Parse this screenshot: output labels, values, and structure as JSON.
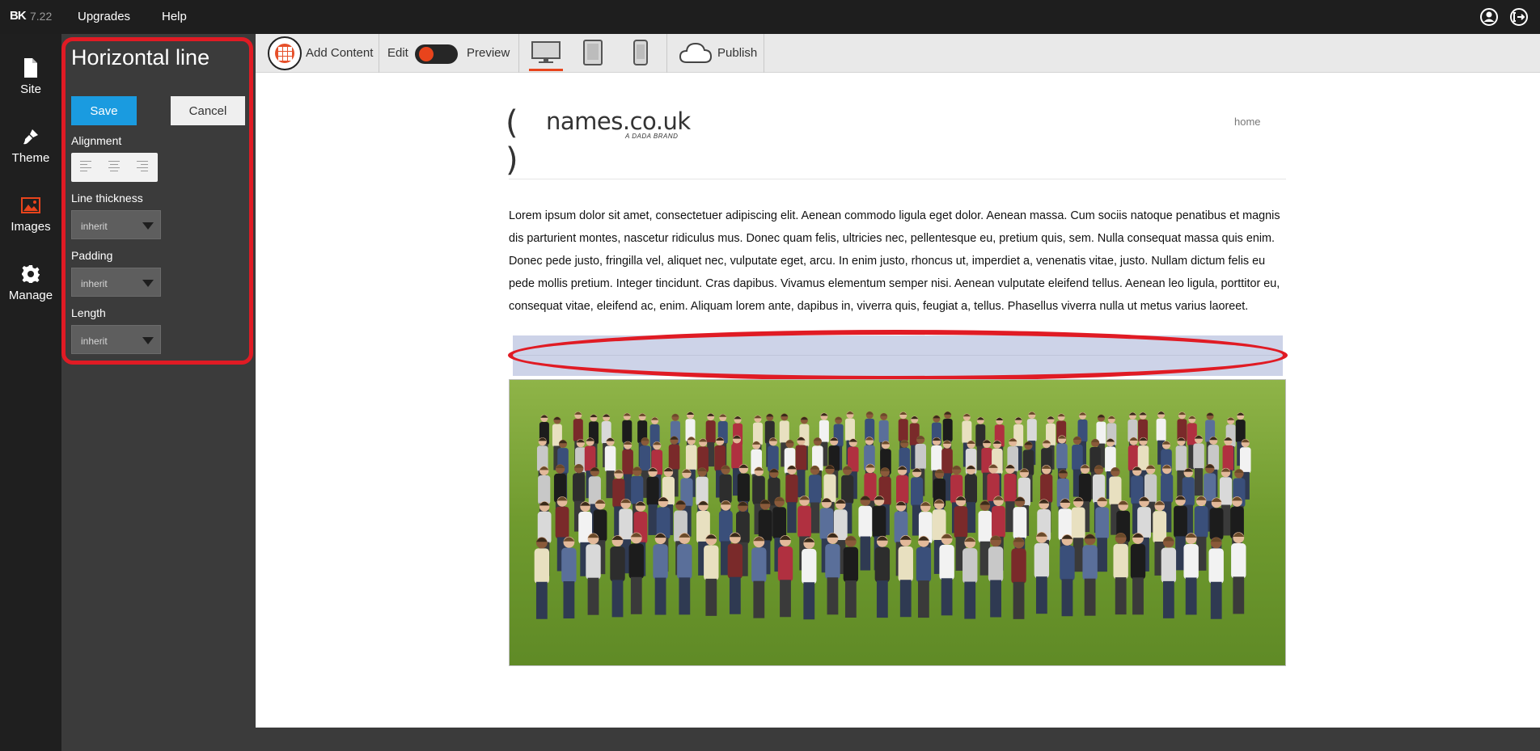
{
  "app": {
    "brand": "BK",
    "version": "7.22"
  },
  "topbar": {
    "menu": [
      "Upgrades",
      "Help"
    ],
    "icons": [
      "account-icon",
      "logout-icon"
    ]
  },
  "rail": [
    {
      "label": "Site",
      "icon": "page-icon"
    },
    {
      "label": "Theme",
      "icon": "brush-icon"
    },
    {
      "label": "Images",
      "icon": "image-icon"
    },
    {
      "label": "Manage",
      "icon": "gear-icon"
    }
  ],
  "panel": {
    "title": "Horizontal line",
    "save_label": "Save",
    "cancel_label": "Cancel",
    "alignment_label": "Alignment",
    "alignment_options": [
      "align-left",
      "align-center",
      "align-right"
    ],
    "fields": [
      {
        "label": "Line thickness",
        "value": "inherit"
      },
      {
        "label": "Padding",
        "value": "inherit"
      },
      {
        "label": "Length",
        "value": "inherit"
      }
    ]
  },
  "toolbar": {
    "add_content_label": "Add Content",
    "edit_label": "Edit",
    "preview_label": "Preview",
    "devices": [
      "desktop",
      "tablet",
      "mobile"
    ],
    "active_device": "desktop",
    "publish_label": "Publish"
  },
  "site": {
    "logo_paren": "( )",
    "logo_name": "names.co.uk",
    "logo_sub": "A DADA BRAND",
    "nav": [
      "home"
    ],
    "paragraph": "Lorem ipsum dolor sit amet, consectetuer adipiscing elit. Aenean commodo ligula eget dolor. Aenean massa. Cum sociis natoque penatibus et magnis dis parturient montes, nascetur ridiculus mus. Donec quam felis, ultricies nec, pellentesque eu, pretium quis, sem. Nulla consequat massa quis enim. Donec pede justo, fringilla vel, aliquet nec, vulputate eget, arcu. In enim justo, rhoncus ut, imperdiet a, venenatis vitae, justo. Nullam dictum felis eu pede mollis pretium. Integer tincidunt. Cras dapibus. Vivamus elementum semper nisi. Aenean vulputate eleifend tellus. Aenean leo ligula, porttitor eu, consequat vitae, eleifend ac, enim. Aliquam lorem ante, dapibus in, viverra quis, feugiat a, tellus. Phasellus viverra nulla ut metus varius laoreet."
  },
  "colors": {
    "accent": "#1a9be0",
    "highlight": "#e01b24",
    "toggle_knob": "#e8441c",
    "selected_block": "#cdd3e8"
  }
}
